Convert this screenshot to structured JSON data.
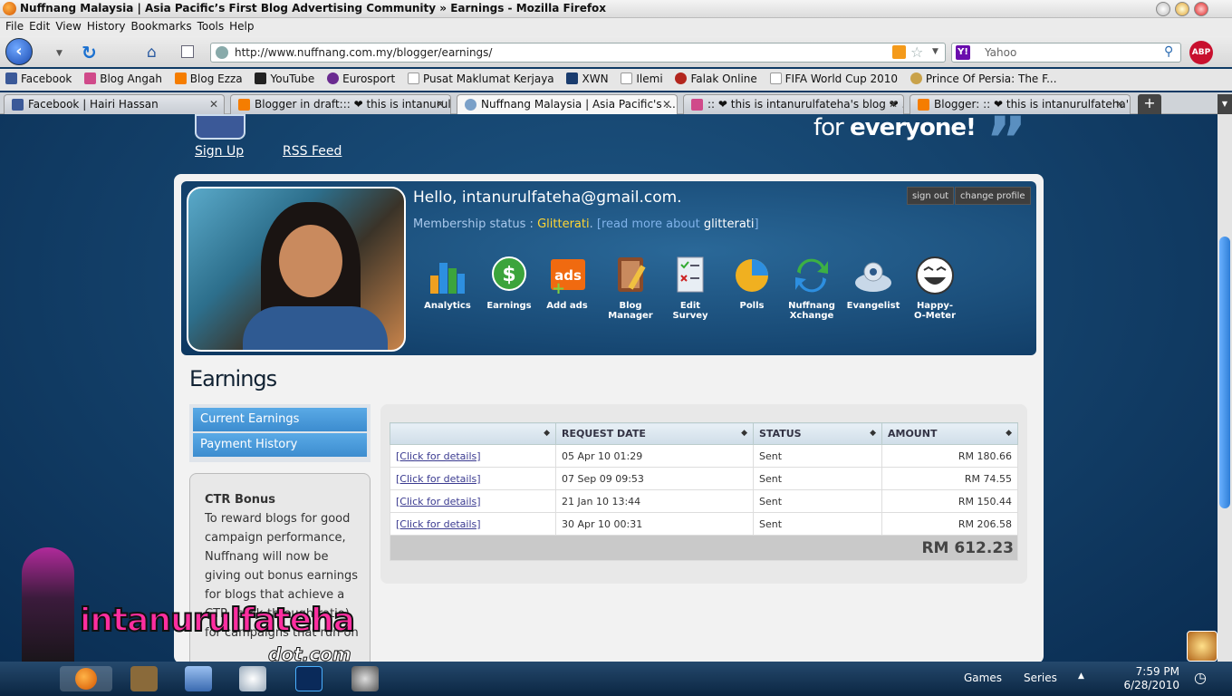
{
  "window": {
    "title": "Nuffnang Malaysia | Asia Pacific’s First Blog Advertising Community » Earnings - Mozilla Firefox"
  },
  "menu": [
    "File",
    "Edit",
    "View",
    "History",
    "Bookmarks",
    "Tools",
    "Help"
  ],
  "nav": {
    "url": "http://www.nuffnang.com.my/blogger/earnings/",
    "search_placeholder": "Yahoo",
    "abp_label": "ABP"
  },
  "bookmarks": [
    {
      "label": "Facebook",
      "color": "#3b5998"
    },
    {
      "label": "Blog Angah",
      "color": "#d04a8a"
    },
    {
      "label": "Blog Ezza",
      "color": "#f57d00"
    },
    {
      "label": "YouTube",
      "color": "#222222"
    },
    {
      "label": "Eurosport",
      "color": "#6a2a90"
    },
    {
      "label": "Pusat Maklumat Kerjaya",
      "color": "#ffffff"
    },
    {
      "label": "XWN",
      "color": "#1a3c6e"
    },
    {
      "label": "Ilemi",
      "color": "#ffffff"
    },
    {
      "label": "Falak Online",
      "color": "#b3261e"
    },
    {
      "label": "FIFA World Cup 2010",
      "color": "#ffffff"
    },
    {
      "label": "Prince Of Persia: The F...",
      "color": "#c9a24a"
    }
  ],
  "tabs": [
    {
      "label": "Facebook | Hairi Hassan",
      "color": "#3b5998",
      "active": false
    },
    {
      "label": "Blogger in draft::: ❤ this is intanurul...",
      "color": "#f57d00",
      "active": false
    },
    {
      "label": "Nuffnang Malaysia | Asia Pacific's ...",
      "color": "#7aa0c8",
      "active": true
    },
    {
      "label": ":: ❤ this is intanurulfateha's blog ❤ ...",
      "color": "#d04a8a",
      "active": false
    },
    {
      "label": "Blogger: :: ❤ this is intanurulfateha'...",
      "color": "#f57d00",
      "active": false
    }
  ],
  "page": {
    "signup": "Sign Up",
    "rss": "RSS Feed",
    "tagline_pre": "for ",
    "tagline_bold": "everyone!",
    "hello": "Hello, intanurulfateha@gmail.com.",
    "member_label": "Membership status : ",
    "member_status": "Glitterati",
    "member_dot": ".",
    "readmore_pre": "[read more about ",
    "readmore_word": "glitterati",
    "readmore_post": "]",
    "signout": "sign out",
    "change_profile": "change profile",
    "icons": [
      {
        "label": "Analytics",
        "icon": "bar-chart-icon",
        "color": "#2d8fe0"
      },
      {
        "label": "Earnings",
        "icon": "dollar-icon",
        "color": "#3ca43c"
      },
      {
        "label": "Add ads",
        "icon": "ads-icon",
        "color": "#f06a10"
      },
      {
        "label": "Blog\nManager",
        "icon": "notebook-icon",
        "color": "#8a4b2a"
      },
      {
        "label": "Edit\nSurvey",
        "icon": "checklist-icon",
        "color": "#e8eef4"
      },
      {
        "label": "Polls",
        "icon": "pie-chart-icon",
        "color": "#f0b020"
      },
      {
        "label": "Nuffnang\nXchange",
        "icon": "exchange-arrows-icon",
        "color": "#3cb044"
      },
      {
        "label": "Evangelist",
        "icon": "evangelist-icon",
        "color": "#c8d8e8"
      },
      {
        "label": "Happy-\nO-Meter",
        "icon": "smiley-icon",
        "color": "#ffffff"
      }
    ],
    "earnings_title": "Earnings",
    "sidenav": [
      "Current Earnings",
      "Payment History"
    ],
    "ctr": {
      "title": "CTR Bonus",
      "body": "To reward blogs for good campaign performance, Nuffnang will now be giving out bonus earnings for blogs that achieve a CTR (click-through-ratio) for campaigns that run on"
    },
    "table": {
      "headers": [
        "",
        "REQUEST DATE",
        "STATUS",
        "AMOUNT"
      ],
      "rows": [
        {
          "link": "[Click for details]",
          "date": "05 Apr 10 01:29",
          "status": "Sent",
          "amount": "RM 180.66"
        },
        {
          "link": "[Click for details]",
          "date": "07 Sep 09 09:53",
          "status": "Sent",
          "amount": "RM 74.55"
        },
        {
          "link": "[Click for details]",
          "date": "21 Jan 10 13:44",
          "status": "Sent",
          "amount": "RM 150.44"
        },
        {
          "link": "[Click for details]",
          "date": "30 Apr 10 00:31",
          "status": "Sent",
          "amount": "RM 206.58"
        }
      ],
      "total": "RM 612.23"
    }
  },
  "watermark": {
    "name": "intanurulfateha",
    "domain": "dot.com"
  },
  "taskbar": {
    "games": "Games",
    "series": "Series",
    "time": "7:59 PM",
    "date": "6/28/2010"
  }
}
